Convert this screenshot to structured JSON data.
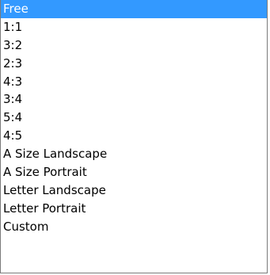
{
  "dropdown": {
    "selected_index": 0,
    "selected_color": "#3399ff",
    "items": [
      {
        "label": "Free"
      },
      {
        "label": "1:1"
      },
      {
        "label": "3:2"
      },
      {
        "label": "2:3"
      },
      {
        "label": "4:3"
      },
      {
        "label": "3:4"
      },
      {
        "label": "5:4"
      },
      {
        "label": "4:5"
      },
      {
        "label": "A Size Landscape"
      },
      {
        "label": "A Size Portrait"
      },
      {
        "label": "Letter Landscape"
      },
      {
        "label": "Letter Portrait"
      },
      {
        "label": "Custom"
      }
    ]
  }
}
